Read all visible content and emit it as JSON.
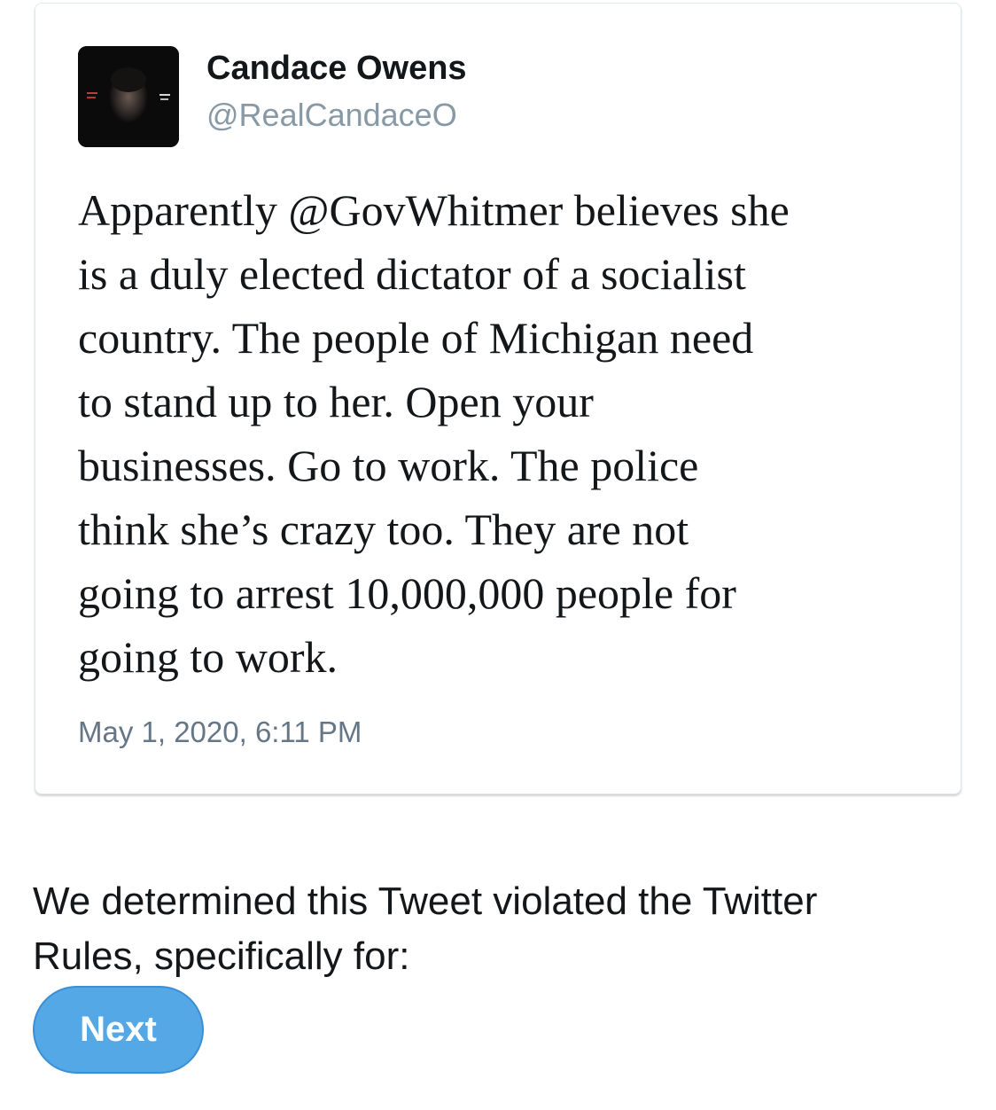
{
  "tweet": {
    "author": {
      "display_name": "Candace Owens",
      "handle": "@RealCandaceO"
    },
    "text_lines": [
      "Apparently @GovWhitmer believes she",
      "is a duly elected dictator of a socialist",
      "country. The people of Michigan need",
      "to stand up to her. Open your",
      "businesses. Go to work. The police",
      "think she’s crazy too. They are not",
      "going to arrest 10,000,000 people for",
      "going to work."
    ],
    "timestamp": "May 1, 2020, 6:11 PM"
  },
  "notice": {
    "lines": [
      "We determined this Tweet violated the Twitter",
      "Rules, specifically for:"
    ]
  },
  "next_button": {
    "label": "Next",
    "color": "#55a8e6"
  },
  "icons": {
    "avatar": "profile-photo"
  }
}
